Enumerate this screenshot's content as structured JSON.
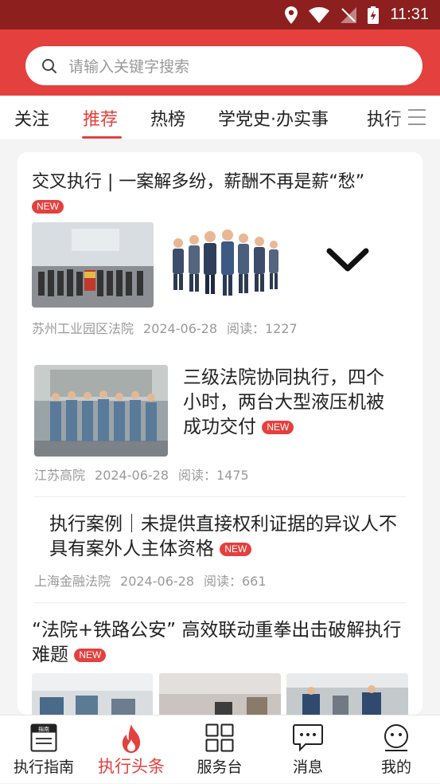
{
  "status_bar": {
    "time": "11:31"
  },
  "search": {
    "placeholder": "请输入关键字搜索"
  },
  "tabs": [
    {
      "label": "关注"
    },
    {
      "label": "推荐"
    },
    {
      "label": "热榜"
    },
    {
      "label": "学党史·办实事"
    },
    {
      "label": "执行"
    }
  ],
  "active_tab": "推荐",
  "articles": [
    {
      "title": "交叉执行 | 一案解多纷，薪酬不再是薪“愁”",
      "badge": "NEW",
      "source": "苏州工业园区法院",
      "date": "2024-06-28",
      "reads": "阅读：1227"
    },
    {
      "title": "三级法院协同执行，四个小时，两台大型液压机被成功交付",
      "badge": "NEW",
      "source": "江苏高院",
      "date": "2024-06-28",
      "reads": "阅读：1475"
    },
    {
      "title": "执行案例｜未提供直接权利证据的异议人不具有案外人主体资格",
      "badge": "NEW",
      "source": "上海金融法院",
      "date": "2024-06-28",
      "reads": "阅读：661"
    },
    {
      "title": "“法院+铁路公安” 高效联动重拳出击破解执行难题",
      "badge": "NEW"
    }
  ],
  "bottom_nav": [
    {
      "label": "执行指南",
      "icon_text": "指南"
    },
    {
      "label": "执行头条"
    },
    {
      "label": "服务台"
    },
    {
      "label": "消息"
    },
    {
      "label": "我的"
    }
  ],
  "colors": {
    "accent": "#e4403e",
    "status_bar": "#8d1f1f"
  }
}
